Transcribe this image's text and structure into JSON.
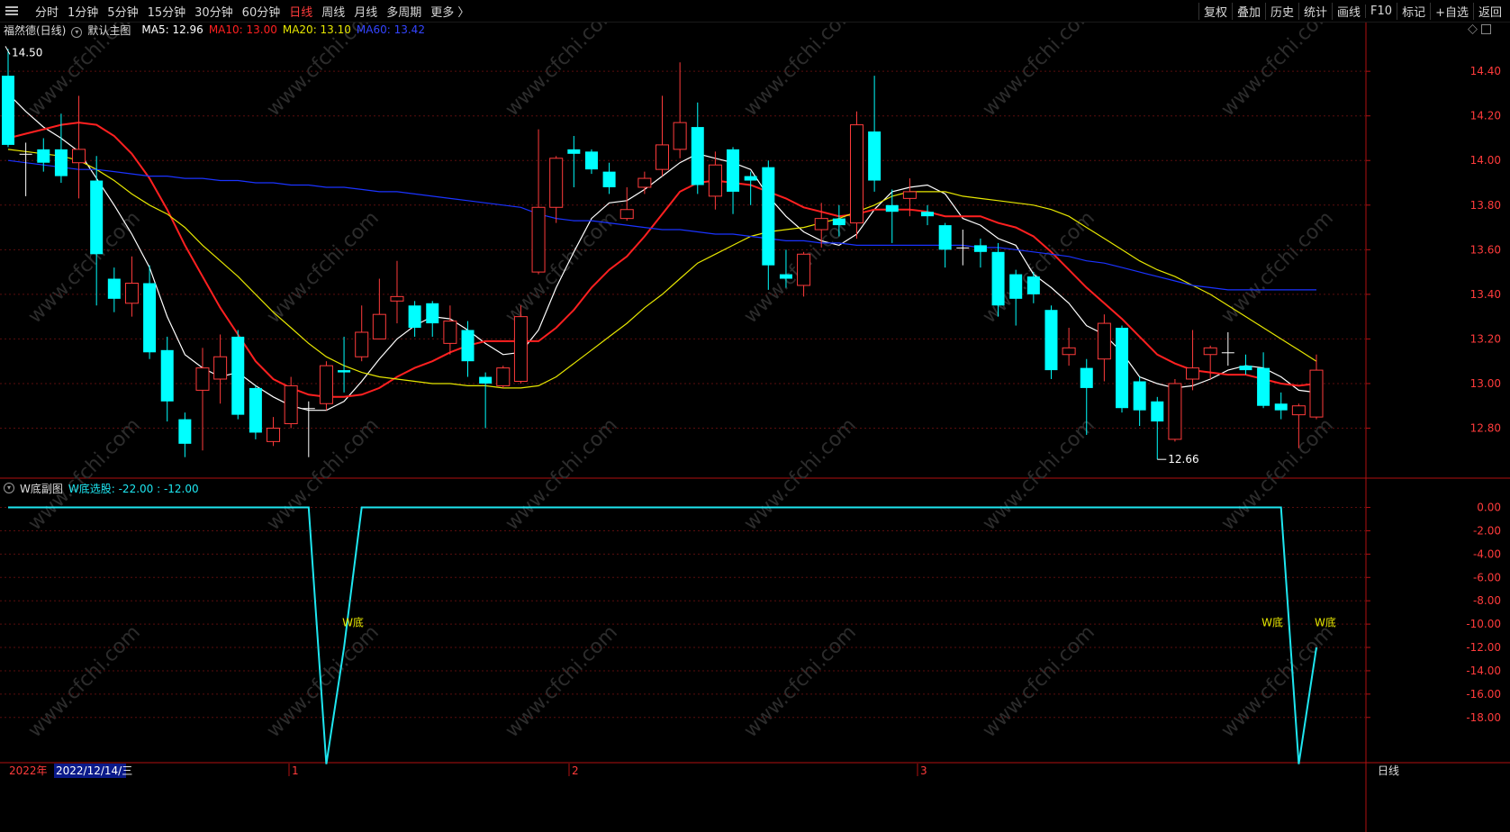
{
  "toolbar": {
    "left_items": [
      "分时",
      "1分钟",
      "5分钟",
      "15分钟",
      "30分钟",
      "60分钟",
      "日线",
      "周线",
      "月线",
      "多周期",
      "更多 〉"
    ],
    "active": "日线",
    "right_items": [
      "复权",
      "叠加",
      "历史",
      "统计",
      "画线",
      "F10",
      "标记",
      "+自选",
      "返回"
    ]
  },
  "main_legend": {
    "stock": "福然德(日线)",
    "template": "默认主图",
    "ma5": "MA5: 12.96",
    "ma10": "MA10: 13.00",
    "ma20": "MA20: 13.10",
    "ma60": "MA60: 13.42",
    "colors": {
      "ma5": "#ffffff",
      "ma10": "#ff2020",
      "ma20": "#e6e600",
      "ma60": "#1a33ff"
    }
  },
  "sub_legend": {
    "name": "W底副图",
    "indicator": "W底选股: -22.00 : -12.00"
  },
  "watermark": "www.cfchi.com",
  "bottom_axis": {
    "year": "2022年",
    "date": "2022/12/14/三",
    "months": [
      "1",
      "2",
      "3"
    ],
    "period_label": "日线"
  },
  "chart_data": [
    {
      "type": "candlestick",
      "title": "福然德(日线)",
      "ylim": [
        12.58,
        14.55
      ],
      "y_ticks": [
        "14.40",
        "14.20",
        "14.00",
        "13.80",
        "13.60",
        "13.40",
        "13.20",
        "13.00",
        "12.80"
      ],
      "annotations": [
        {
          "text": "14.50",
          "label": "high"
        },
        {
          "text": "12.66",
          "label": "low"
        }
      ],
      "up_color": "#ff3b3b",
      "down_color": "#00ffff",
      "candles": [
        [
          14.38,
          14.07,
          14.5,
          14.06
        ],
        [
          14.03,
          14.03,
          14.08,
          13.84
        ],
        [
          14.05,
          13.99,
          14.1,
          13.95
        ],
        [
          14.05,
          13.93,
          14.21,
          13.9
        ],
        [
          13.99,
          14.05,
          14.29,
          13.83
        ],
        [
          13.91,
          13.58,
          14.02,
          13.35
        ],
        [
          13.47,
          13.38,
          13.52,
          13.32
        ],
        [
          13.36,
          13.45,
          13.57,
          13.3
        ],
        [
          13.45,
          13.14,
          13.53,
          13.11
        ],
        [
          13.15,
          12.92,
          13.21,
          12.83
        ],
        [
          12.84,
          12.73,
          12.87,
          12.67
        ],
        [
          12.97,
          13.07,
          13.16,
          12.7
        ],
        [
          13.02,
          13.12,
          13.22,
          12.91
        ],
        [
          13.21,
          12.86,
          13.24,
          12.84
        ],
        [
          12.98,
          12.78,
          12.99,
          12.75
        ],
        [
          12.74,
          12.8,
          12.85,
          12.72
        ],
        [
          12.82,
          12.99,
          13.03,
          12.8
        ],
        [
          12.89,
          12.89,
          12.92,
          12.67
        ],
        [
          12.91,
          13.08,
          13.1,
          12.88
        ],
        [
          13.06,
          13.05,
          13.21,
          12.96
        ],
        [
          13.12,
          13.23,
          13.35,
          13.1
        ],
        [
          13.2,
          13.31,
          13.47,
          13.2
        ],
        [
          13.37,
          13.39,
          13.55,
          13.27
        ],
        [
          13.35,
          13.25,
          13.37,
          13.21
        ],
        [
          13.36,
          13.27,
          13.37,
          13.21
        ],
        [
          13.18,
          13.28,
          13.35,
          13.13
        ],
        [
          13.24,
          13.1,
          13.28,
          13.03
        ],
        [
          13.03,
          13.0,
          13.05,
          12.8
        ],
        [
          12.99,
          13.07,
          13.08,
          12.98
        ],
        [
          13.01,
          13.3,
          13.35,
          13.0
        ],
        [
          13.5,
          13.79,
          14.14,
          13.49
        ],
        [
          13.79,
          14.01,
          14.02,
          13.72
        ],
        [
          14.05,
          14.03,
          14.11,
          13.88
        ],
        [
          14.04,
          13.96,
          14.05,
          13.94
        ],
        [
          13.95,
          13.88,
          13.99,
          13.85
        ],
        [
          13.74,
          13.78,
          13.88,
          13.73
        ],
        [
          13.88,
          13.92,
          13.95,
          13.85
        ],
        [
          13.96,
          14.07,
          14.29,
          13.93
        ],
        [
          14.05,
          14.17,
          14.44,
          14.01
        ],
        [
          14.15,
          13.89,
          14.26,
          13.85
        ],
        [
          13.84,
          13.98,
          14.04,
          13.78
        ],
        [
          14.05,
          13.86,
          14.06,
          13.76
        ],
        [
          13.93,
          13.91,
          13.95,
          13.8
        ],
        [
          13.97,
          13.53,
          14.0,
          13.42
        ],
        [
          13.49,
          13.47,
          13.6,
          13.43
        ],
        [
          13.44,
          13.58,
          13.59,
          13.39
        ],
        [
          13.69,
          13.74,
          13.81,
          13.61
        ],
        [
          13.74,
          13.71,
          13.8,
          13.66
        ],
        [
          13.72,
          14.16,
          14.22,
          13.65
        ],
        [
          14.13,
          13.91,
          14.38,
          13.86
        ],
        [
          13.8,
          13.77,
          13.87,
          13.63
        ],
        [
          13.83,
          13.86,
          13.92,
          13.75
        ],
        [
          13.77,
          13.75,
          13.8,
          13.71
        ],
        [
          13.71,
          13.6,
          13.72,
          13.52
        ],
        [
          13.61,
          13.61,
          13.69,
          13.53
        ],
        [
          13.62,
          13.59,
          13.65,
          13.52
        ],
        [
          13.59,
          13.35,
          13.63,
          13.3
        ],
        [
          13.49,
          13.38,
          13.51,
          13.26
        ],
        [
          13.48,
          13.4,
          13.5,
          13.36
        ],
        [
          13.33,
          13.06,
          13.35,
          13.02
        ],
        [
          13.13,
          13.16,
          13.25,
          13.08
        ],
        [
          13.07,
          12.98,
          13.11,
          12.77
        ],
        [
          13.11,
          13.27,
          13.31,
          13.01
        ],
        [
          13.25,
          12.89,
          13.26,
          12.87
        ],
        [
          13.01,
          12.88,
          13.03,
          12.81
        ],
        [
          12.92,
          12.83,
          12.94,
          12.66
        ],
        [
          12.75,
          13.0,
          13.02,
          12.74
        ],
        [
          13.02,
          13.07,
          13.24,
          12.97
        ],
        [
          13.13,
          13.16,
          13.17,
          13.02
        ],
        [
          13.14,
          13.14,
          13.23,
          13.08
        ],
        [
          13.08,
          13.06,
          13.13,
          13.04
        ],
        [
          13.07,
          12.9,
          13.14,
          12.89
        ],
        [
          12.91,
          12.88,
          12.96,
          12.84
        ],
        [
          12.86,
          12.9,
          12.91,
          12.71
        ],
        [
          12.85,
          13.06,
          13.13,
          12.84
        ]
      ],
      "series": [
        {
          "name": "MA5",
          "color": "#ffffff",
          "values": [
            14.3,
            14.22,
            14.15,
            14.1,
            14.04,
            13.92,
            13.8,
            13.67,
            13.52,
            13.3,
            13.13,
            13.07,
            13.03,
            13.05,
            12.99,
            12.94,
            12.9,
            12.88,
            12.88,
            12.92,
            13.01,
            13.11,
            13.2,
            13.26,
            13.3,
            13.29,
            13.24,
            13.18,
            13.13,
            13.14,
            13.24,
            13.43,
            13.59,
            13.74,
            13.81,
            13.82,
            13.87,
            13.93,
            13.99,
            14.03,
            14.01,
            13.99,
            13.96,
            13.84,
            13.75,
            13.68,
            13.64,
            13.62,
            13.67,
            13.78,
            13.86,
            13.88,
            13.89,
            13.85,
            13.74,
            13.71,
            13.65,
            13.62,
            13.49,
            13.43,
            13.36,
            13.26,
            13.22,
            13.14,
            13.03,
            13.0,
            12.98,
            12.99,
            13.02,
            13.06,
            13.08,
            13.07,
            13.03,
            12.97,
            12.96
          ]
        },
        {
          "name": "MA10",
          "color": "#ff2020",
          "values": [
            14.1,
            14.12,
            14.14,
            14.16,
            14.17,
            14.16,
            14.11,
            14.03,
            13.92,
            13.78,
            13.62,
            13.48,
            13.34,
            13.22,
            13.1,
            13.02,
            12.98,
            12.95,
            12.94,
            12.94,
            12.95,
            12.98,
            13.03,
            13.07,
            13.1,
            13.14,
            13.17,
            13.19,
            13.19,
            13.19,
            13.19,
            13.25,
            13.33,
            13.43,
            13.51,
            13.57,
            13.66,
            13.76,
            13.86,
            13.9,
            13.91,
            13.9,
            13.89,
            13.86,
            13.83,
            13.79,
            13.77,
            13.75,
            13.76,
            13.78,
            13.78,
            13.78,
            13.77,
            13.75,
            13.75,
            13.75,
            13.72,
            13.7,
            13.66,
            13.59,
            13.51,
            13.43,
            13.36,
            13.29,
            13.21,
            13.13,
            13.09,
            13.06,
            13.05,
            13.04,
            13.04,
            13.02,
            13.0,
            12.99,
            13.0
          ]
        },
        {
          "name": "MA20",
          "color": "#e6e600",
          "values": [
            14.05,
            14.04,
            14.03,
            14.02,
            14.0,
            13.96,
            13.91,
            13.85,
            13.8,
            13.76,
            13.7,
            13.62,
            13.55,
            13.48,
            13.4,
            13.32,
            13.25,
            13.18,
            13.12,
            13.08,
            13.05,
            13.03,
            13.02,
            13.01,
            13.0,
            13.0,
            12.99,
            12.99,
            12.98,
            12.98,
            12.99,
            13.03,
            13.09,
            13.15,
            13.21,
            13.27,
            13.34,
            13.4,
            13.47,
            13.54,
            13.58,
            13.62,
            13.66,
            13.68,
            13.69,
            13.7,
            13.72,
            13.74,
            13.77,
            13.8,
            13.84,
            13.86,
            13.86,
            13.86,
            13.84,
            13.83,
            13.82,
            13.81,
            13.8,
            13.78,
            13.75,
            13.7,
            13.65,
            13.6,
            13.55,
            13.51,
            13.48,
            13.44,
            13.4,
            13.35,
            13.3,
            13.25,
            13.2,
            13.15,
            13.1
          ]
        },
        {
          "name": "MA60",
          "color": "#1a33ff",
          "values": [
            14.0,
            13.99,
            13.98,
            13.97,
            13.96,
            13.96,
            13.95,
            13.94,
            13.93,
            13.93,
            13.92,
            13.92,
            13.91,
            13.91,
            13.9,
            13.9,
            13.89,
            13.89,
            13.88,
            13.88,
            13.87,
            13.86,
            13.86,
            13.85,
            13.84,
            13.83,
            13.82,
            13.81,
            13.8,
            13.79,
            13.76,
            13.74,
            13.73,
            13.73,
            13.72,
            13.71,
            13.7,
            13.69,
            13.69,
            13.68,
            13.67,
            13.67,
            13.66,
            13.65,
            13.64,
            13.64,
            13.63,
            13.63,
            13.62,
            13.62,
            13.62,
            13.62,
            13.62,
            13.62,
            13.62,
            13.61,
            13.61,
            13.6,
            13.59,
            13.58,
            13.57,
            13.55,
            13.54,
            13.52,
            13.5,
            13.48,
            13.46,
            13.44,
            13.43,
            13.42,
            13.42,
            13.42,
            13.42,
            13.42,
            13.42
          ]
        }
      ]
    },
    {
      "type": "line",
      "title": "W底副图",
      "ylim": [
        -21.8,
        1.2
      ],
      "y_ticks": [
        "0.00",
        "-2.00",
        "-4.00",
        "-6.00",
        "-8.00",
        "-10.00",
        "-12.00",
        "-14.00",
        "-16.00",
        "-18.00"
      ],
      "series": [
        {
          "name": "W底选股",
          "color": "#1ee6f0",
          "values": [
            0,
            0,
            0,
            0,
            0,
            0,
            0,
            0,
            0,
            0,
            0,
            0,
            0,
            0,
            0,
            0,
            0,
            0,
            -22,
            -12,
            0,
            0,
            0,
            0,
            0,
            0,
            0,
            0,
            0,
            0,
            0,
            0,
            0,
            0,
            0,
            0,
            0,
            0,
            0,
            0,
            0,
            0,
            0,
            0,
            0,
            0,
            0,
            0,
            0,
            0,
            0,
            0,
            0,
            0,
            0,
            0,
            0,
            0,
            0,
            0,
            0,
            0,
            0,
            0,
            0,
            0,
            0,
            0,
            0,
            0,
            0,
            0,
            0,
            -22,
            -12
          ]
        }
      ],
      "annotations": [
        {
          "text": "W底",
          "index": 19
        },
        {
          "text": "W底",
          "index": 71
        },
        {
          "text": "W底",
          "index": 74
        }
      ]
    }
  ]
}
